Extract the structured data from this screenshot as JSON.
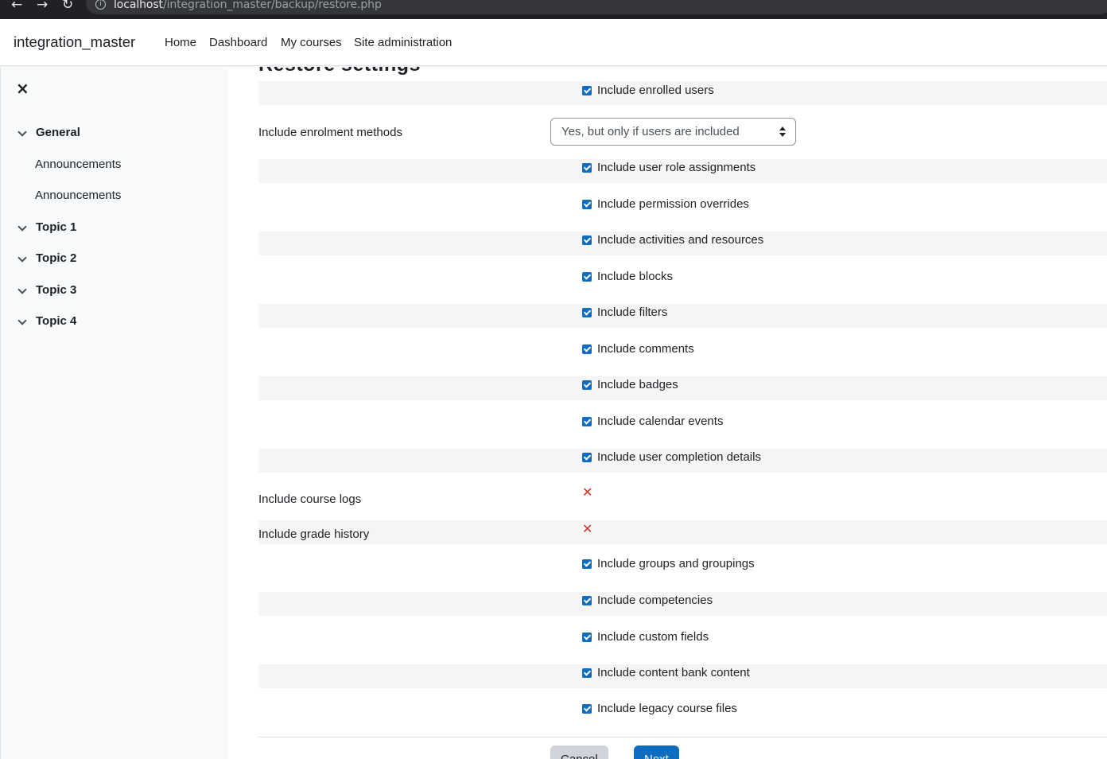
{
  "browser": {
    "url_host": "localhost",
    "url_path": "/integration_master/backup/restore.php"
  },
  "navbar": {
    "brand": "integration_master",
    "links": [
      "Home",
      "Dashboard",
      "My courses",
      "Site administration"
    ]
  },
  "drawer": {
    "close_icon": "×",
    "items": [
      {
        "type": "section",
        "label": "General"
      },
      {
        "type": "activity",
        "label": "Announcements"
      },
      {
        "type": "activity",
        "label": "Announcements"
      },
      {
        "type": "section",
        "label": "Topic 1"
      },
      {
        "type": "section",
        "label": "Topic 2"
      },
      {
        "type": "section",
        "label": "Topic 3"
      },
      {
        "type": "section",
        "label": "Topic 4"
      }
    ]
  },
  "main": {
    "heading": "Restore settings",
    "enrolment": {
      "label": "Include enrolment methods",
      "selected": "Yes, but only if users are included"
    },
    "settings": [
      {
        "label": "",
        "text": "Include enrolled users",
        "state": "checked"
      },
      {
        "label": "",
        "text": "Include user role assignments",
        "state": "checked"
      },
      {
        "label": "",
        "text": "Include permission overrides",
        "state": "checked"
      },
      {
        "label": "",
        "text": "Include activities and resources",
        "state": "checked"
      },
      {
        "label": "",
        "text": "Include blocks",
        "state": "checked"
      },
      {
        "label": "",
        "text": "Include filters",
        "state": "checked"
      },
      {
        "label": "",
        "text": "Include comments",
        "state": "checked"
      },
      {
        "label": "",
        "text": "Include badges",
        "state": "checked"
      },
      {
        "label": "",
        "text": "Include calendar events",
        "state": "checked"
      },
      {
        "label": "",
        "text": "Include user completion details",
        "state": "checked"
      },
      {
        "label": "Include course logs",
        "text": "",
        "state": "disabled"
      },
      {
        "label": "Include grade history",
        "text": "",
        "state": "disabled"
      },
      {
        "label": "",
        "text": "Include groups and groupings",
        "state": "checked"
      },
      {
        "label": "",
        "text": "Include competencies",
        "state": "checked"
      },
      {
        "label": "",
        "text": "Include custom fields",
        "state": "checked"
      },
      {
        "label": "",
        "text": "Include content bank content",
        "state": "checked"
      },
      {
        "label": "",
        "text": "Include legacy course files",
        "state": "checked"
      }
    ],
    "buttons": {
      "cancel": "Cancel",
      "next": "Next"
    }
  },
  "colors": {
    "accent": "#0f6cbf",
    "error": "#ca3120",
    "row_shade": "#f5f5f5"
  }
}
